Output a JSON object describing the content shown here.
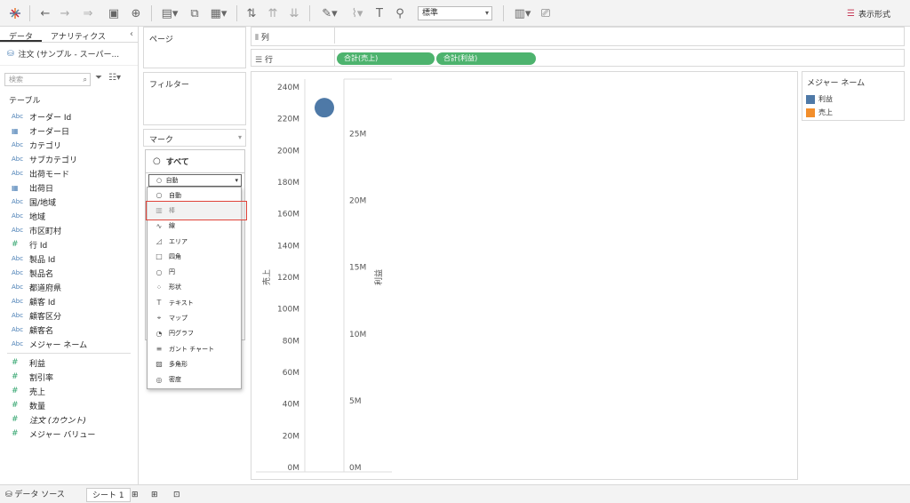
{
  "toolbar": {
    "format_select": "標準",
    "show_me": "表示形式"
  },
  "left_panel": {
    "tab_data": "データ",
    "tab_analytics": "アナリティクス",
    "datasource": "注文 (サンプル - スーパー...",
    "search_placeholder": "検索",
    "section_tables": "テーブル",
    "dimensions": [
      {
        "type": "Abc",
        "name": "オーダー Id"
      },
      {
        "type": "date",
        "name": "オーダー日"
      },
      {
        "type": "Abc",
        "name": "カテゴリ"
      },
      {
        "type": "Abc",
        "name": "サブカテゴリ"
      },
      {
        "type": "Abc",
        "name": "出荷モード"
      },
      {
        "type": "date",
        "name": "出荷日"
      },
      {
        "type": "Abc",
        "name": "国/地域"
      },
      {
        "type": "Abc",
        "name": "地域"
      },
      {
        "type": "Abc",
        "name": "市区町村"
      },
      {
        "type": "#",
        "name": "行 Id"
      },
      {
        "type": "Abc",
        "name": "製品 Id"
      },
      {
        "type": "Abc",
        "name": "製品名"
      },
      {
        "type": "Abc",
        "name": "都道府県"
      },
      {
        "type": "Abc",
        "name": "顧客 Id"
      },
      {
        "type": "Abc",
        "name": "顧客区分"
      },
      {
        "type": "Abc",
        "name": "顧客名"
      },
      {
        "type": "Abc",
        "name": "メジャー ネーム"
      }
    ],
    "measures": [
      {
        "type": "#",
        "name": "利益",
        "italic": false
      },
      {
        "type": "#",
        "name": "割引率",
        "italic": false
      },
      {
        "type": "#",
        "name": "売上",
        "italic": false
      },
      {
        "type": "#",
        "name": "数量",
        "italic": false
      },
      {
        "type": "#",
        "name": "注文 (カウント)",
        "italic": true
      },
      {
        "type": "#",
        "name": "メジャー バリュー",
        "italic": false
      }
    ]
  },
  "cards": {
    "pages": "ページ",
    "filters": "フィルター",
    "marks": "マーク"
  },
  "marks": {
    "all": "すべて",
    "selected": "自動",
    "options": [
      {
        "icon": "○",
        "label": "自動"
      },
      {
        "icon": "▥",
        "label": "棒"
      },
      {
        "icon": "∿",
        "label": "線"
      },
      {
        "icon": "◿",
        "label": "エリア"
      },
      {
        "icon": "□",
        "label": "四角"
      },
      {
        "icon": "○",
        "label": "円"
      },
      {
        "icon": "⁘",
        "label": "形状"
      },
      {
        "icon": "T",
        "label": "テキスト"
      },
      {
        "icon": "⌖",
        "label": "マップ"
      },
      {
        "icon": "◔",
        "label": "円グラフ"
      },
      {
        "icon": "≡",
        "label": "ガント チャート"
      },
      {
        "icon": "▨",
        "label": "多角形"
      },
      {
        "icon": "◎",
        "label": "密度"
      }
    ]
  },
  "shelves": {
    "columns": "列",
    "rows": "行",
    "row_pills": [
      "合計(売上)",
      "合計(利益)"
    ]
  },
  "chart_data": {
    "type": "scatter",
    "left_axis": {
      "label": "売上",
      "ticks": [
        "240M",
        "220M",
        "200M",
        "180M",
        "160M",
        "140M",
        "120M",
        "100M",
        "80M",
        "60M",
        "40M",
        "20M",
        "0M"
      ],
      "range": [
        0,
        240
      ]
    },
    "right_axis": {
      "label": "利益",
      "ticks": [
        "25M",
        "20M",
        "15M",
        "10M",
        "5M",
        "0M"
      ],
      "range": [
        0,
        28.5
      ]
    },
    "points": [
      {
        "series": "利益",
        "value": 227
      }
    ],
    "legend": {
      "title": "メジャー ネーム",
      "entries": [
        {
          "name": "利益",
          "color": "#4e79a7"
        },
        {
          "name": "売上",
          "color": "#f28e2b"
        }
      ]
    }
  },
  "bottom": {
    "datasource_tab": "データ ソース",
    "sheet_tab": "シート 1"
  },
  "colors": {
    "accent_green": "#4db36e",
    "highlight_red": "#e0443a"
  }
}
